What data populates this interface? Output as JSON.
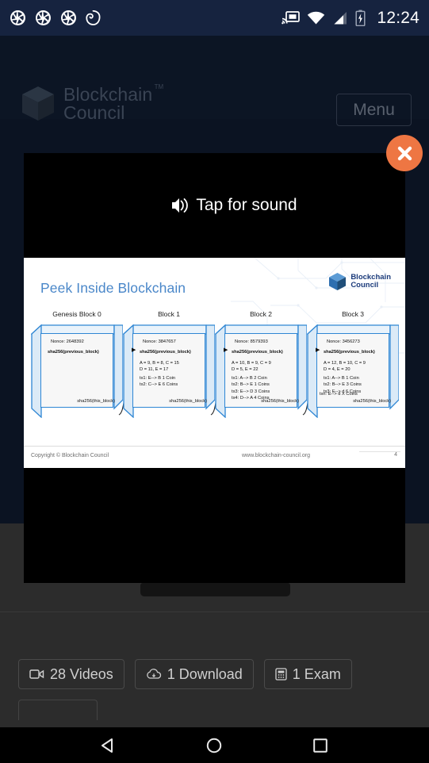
{
  "statusbar": {
    "time": "12:24",
    "icons": [
      "aperture-icon",
      "aperture-icon",
      "aperture-icon",
      "snapchat-ghost-icon"
    ],
    "right_icons": [
      "cast-icon",
      "wifi-icon",
      "cellular-signal-icon",
      "battery-charging-icon"
    ]
  },
  "site_header": {
    "logo_line1": "Blockchain",
    "logo_line2": "Council",
    "logo_tm": "TM",
    "menu_label": "Menu"
  },
  "player": {
    "tap_for_sound": "Tap for sound",
    "close_label": "✕",
    "accent_color": "#ee7643"
  },
  "slide": {
    "title": "Peek Inside Blockchain",
    "logo_line1": "Blockchain",
    "logo_line2": "Council",
    "footer": {
      "copyright": "Copyright © Blockchain Council",
      "website": "www.blockchain-council.org",
      "page_number": "4"
    },
    "blocks": [
      {
        "label": "Genesis Block 0",
        "nonce": "Nonce: 2648392",
        "sha_prev": "sha256(previous_block)",
        "values": [],
        "txs": [],
        "txn": "",
        "sha_this": "sha256(this_block)",
        "has_incoming_arrow": false
      },
      {
        "label": "Block 1",
        "nonce": "Nonce: 3847657",
        "sha_prev": "sha256(previous_block)",
        "values": [
          "A = 9, B = 8, C = 15",
          "D = 11, E = 17"
        ],
        "txs": [
          "tx1: E--> B 1 Coin",
          "tx2: C--> E 6 Coins"
        ],
        "txn": "",
        "sha_this": "sha256(this_block)",
        "has_incoming_arrow": true
      },
      {
        "label": "Block 2",
        "nonce": "Nonce: 8579393",
        "sha_prev": "sha256(previous_block)",
        "values": [
          "A = 10, B = 9, C = 9",
          "D = 5, E = 22"
        ],
        "txs": [
          "tx1: A--> B 2 Coin",
          "tx2: B--> E 1 Coins",
          "tx3: E--> D 3 Coins",
          "tx4: D--> A 4 Coins"
        ],
        "txn": "",
        "sha_this": "sha256(this_block)",
        "has_incoming_arrow": true
      },
      {
        "label": "Block 3",
        "nonce": "Nonce: 3456273",
        "sha_prev": "sha256(previous_block)",
        "values": [
          "A = 12, B = 10, C = 9",
          "D = 4, E = 20"
        ],
        "txs": [
          "tx1: A--> B 1 Coin",
          "tx2: B--> E 3 Coins",
          "tx3: E--> d 6 Coins"
        ],
        "txn": "txn: E--> d X Coins",
        "sha_this": "sha256(this_block)",
        "has_incoming_arrow": true
      }
    ]
  },
  "course_badges": [
    {
      "icon": "video-camera-icon",
      "label": "28 Videos"
    },
    {
      "icon": "cloud-download-icon",
      "label": "1 Download"
    },
    {
      "icon": "exam-document-icon",
      "label": "1 Exam"
    }
  ],
  "navbar": {
    "back": "back-triangle-icon",
    "home": "home-circle-icon",
    "recents": "recents-square-icon"
  }
}
